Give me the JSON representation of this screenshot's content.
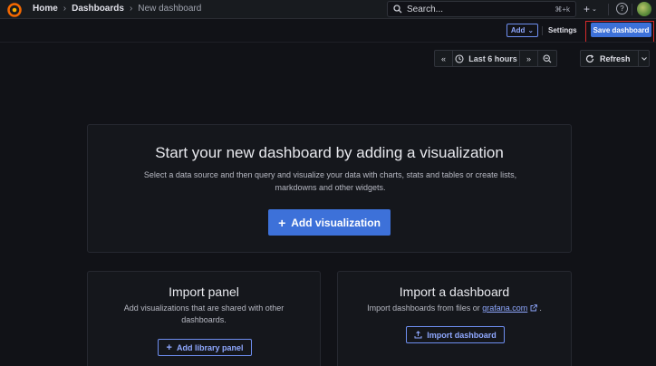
{
  "nav": {
    "breadcrumbs": [
      "Home",
      "Dashboards",
      "New dashboard"
    ],
    "search_placeholder": "Search...",
    "search_shortcut": "⌘+k"
  },
  "toolbar": {
    "add_label": "Add",
    "settings_label": "Settings",
    "save_label": "Save dashboard"
  },
  "time": {
    "range_label": "Last 6 hours",
    "refresh_label": "Refresh"
  },
  "main": {
    "title": "Start your new dashboard by adding a visualization",
    "description_line1": "Select a data source and then query and visualize your data with charts, stats and tables or create lists,",
    "description_line2": "markdowns and other widgets.",
    "add_visualization_label": "Add visualization"
  },
  "import_panel": {
    "title": "Import panel",
    "description_line1": "Add visualizations that are shared with other",
    "description_line2": "dashboards.",
    "button_label": "Add library panel"
  },
  "import_dashboard": {
    "title": "Import a dashboard",
    "description_prefix": "Import dashboards from files or",
    "link_text": "grafana.com",
    "description_suffix": ".",
    "button_label": "Import dashboard"
  },
  "colors": {
    "primary": "#3d71d9",
    "highlight": "#d62b2b",
    "background": "#111217"
  },
  "icons": [
    "grafana-logo-icon",
    "search-icon",
    "plus-icon",
    "help-icon",
    "chevron-down-icon",
    "zoom-back-icon",
    "clock-icon",
    "zoom-forward-icon",
    "zoom-out-icon",
    "refresh-icon",
    "upload-icon",
    "external-link-icon"
  ]
}
